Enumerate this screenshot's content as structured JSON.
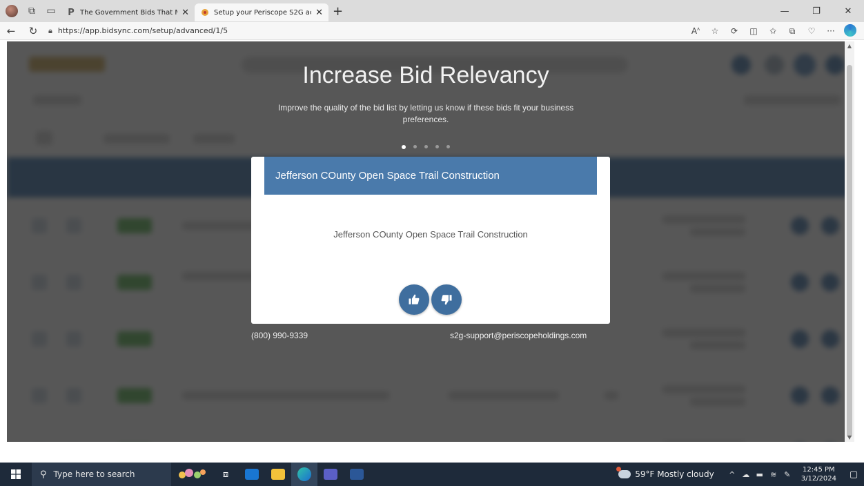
{
  "browser": {
    "tabs": [
      {
        "title": "The Government Bids That Matte",
        "favicon": "periscope-p-icon",
        "active": false
      },
      {
        "title": "Setup your Periscope S2G accou",
        "favicon": "bidsync-icon",
        "active": true
      }
    ],
    "url": "https://app.bidsync.com/setup/advanced/1/5"
  },
  "setup": {
    "title": "Increase Bid Relevancy",
    "subtitle": "Improve the quality of the bid list by letting us know if these bids fit your business preferences.",
    "pager": {
      "total": 5,
      "current": 1
    },
    "card": {
      "header": "Jefferson COunty Open Space Trail Construction",
      "body": "Jefferson COunty Open Space Trail Construction"
    },
    "contact": {
      "phone": "(800) 990-9339",
      "email": "s2g-support@periscopeholdings.com"
    }
  },
  "taskbar": {
    "search_placeholder": "Type here to search",
    "weather": "59°F  Mostly cloudy",
    "time": "12:45 PM",
    "date": "3/12/2024"
  },
  "colors": {
    "card_header": "#4a7aab",
    "vote_button": "#3f6e9e",
    "scrim": "#282828"
  }
}
